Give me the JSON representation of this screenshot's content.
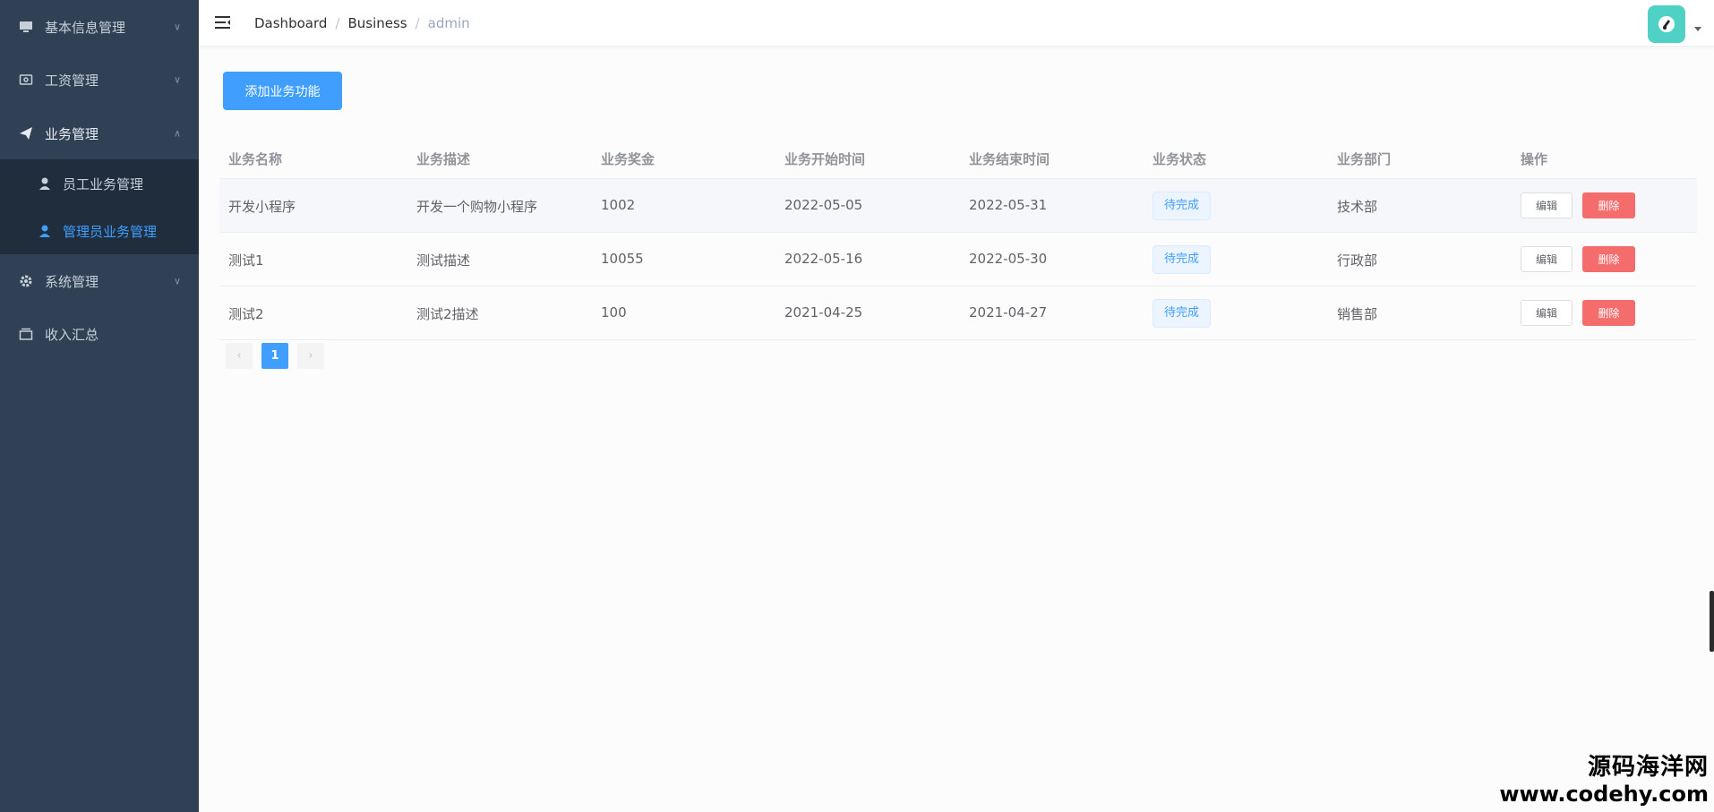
{
  "sidebar": {
    "items": [
      {
        "label": "基本信息管理",
        "icon": "monitor-icon"
      },
      {
        "label": "工资管理",
        "icon": "wallet-icon"
      },
      {
        "label": "业务管理",
        "icon": "paper-plane-icon"
      },
      {
        "label": "系统管理",
        "icon": "gear-icon"
      },
      {
        "label": "收入汇总",
        "icon": "tray-icon"
      }
    ],
    "submenu": [
      {
        "label": "员工业务管理",
        "icon": "user-icon"
      },
      {
        "label": "管理员业务管理",
        "icon": "user-icon",
        "active": true
      }
    ]
  },
  "header": {
    "breadcrumb": [
      "Dashboard",
      "Business",
      "admin"
    ],
    "separator": "/"
  },
  "toolbar": {
    "add_label": "添加业务功能"
  },
  "table": {
    "columns": [
      "业务名称",
      "业务描述",
      "业务奖金",
      "业务开始时间",
      "业务结束时间",
      "业务状态",
      "业务部门",
      "操作"
    ],
    "rows": [
      {
        "name": "开发小程序",
        "desc": "开发一个购物小程序",
        "bonus": "1002",
        "start": "2022-05-05",
        "end": "2022-05-31",
        "status": "待完成",
        "dept": "技术部"
      },
      {
        "name": "测试1",
        "desc": "测试描述",
        "bonus": "10055",
        "start": "2022-05-16",
        "end": "2022-05-30",
        "status": "待完成",
        "dept": "行政部"
      },
      {
        "name": "测试2",
        "desc": "测试2描述",
        "bonus": "100",
        "start": "2021-04-25",
        "end": "2021-04-27",
        "status": "待完成",
        "dept": "销售部"
      }
    ],
    "edit_label": "编辑",
    "delete_label": "删除"
  },
  "pagination": {
    "prev": "‹",
    "current": "1",
    "next": "›"
  },
  "watermark": {
    "line1": "源码海洋网",
    "line2": "www.codehy.com"
  },
  "colors": {
    "sidebar": "#304156",
    "primary": "#409eff",
    "danger": "#f56c6c"
  }
}
